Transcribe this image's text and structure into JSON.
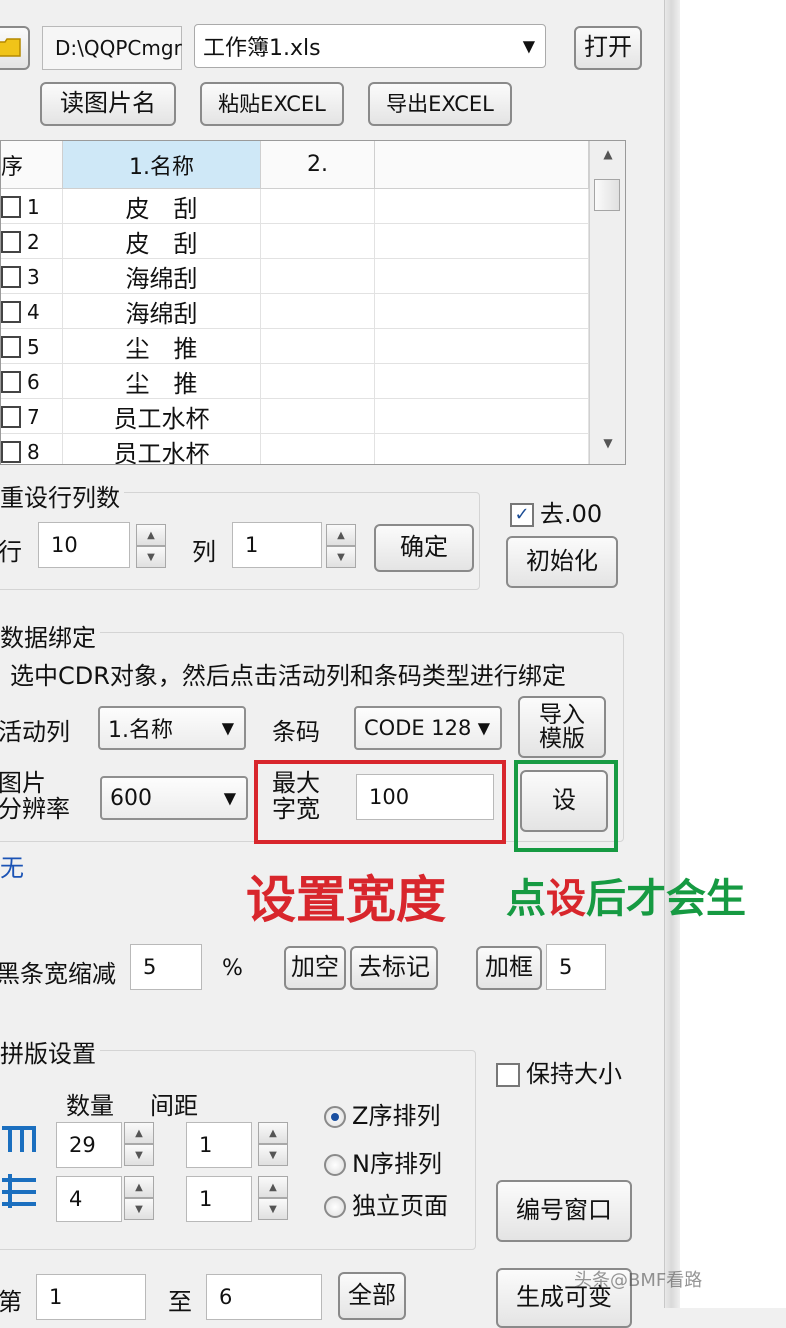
{
  "top": {
    "path_value": "D:\\QQPCmgr",
    "file_combo": "工作簿1.xls",
    "open_btn": "打开",
    "read_names_btn": "读图片名",
    "paste_excel_btn": "粘贴EXCEL",
    "export_excel_btn": "导出EXCEL"
  },
  "grid": {
    "headers": [
      "序",
      "1.名称",
      "2."
    ],
    "rows": [
      {
        "num": "1",
        "name": "皮　刮"
      },
      {
        "num": "2",
        "name": "皮　刮"
      },
      {
        "num": "3",
        "name": "海绵刮"
      },
      {
        "num": "4",
        "name": "海绵刮"
      },
      {
        "num": "5",
        "name": "尘　推"
      },
      {
        "num": "6",
        "name": "尘　推"
      },
      {
        "num": "7",
        "name": "员工水杯"
      },
      {
        "num": "8",
        "name": "员工水杯"
      }
    ]
  },
  "reset": {
    "title": "重设行列数",
    "row_label": "行",
    "row_value": "10",
    "col_label": "列",
    "col_value": "1",
    "ok_btn": "确定",
    "strip_zero_label": "去.00",
    "strip_zero_checked": true,
    "init_btn": "初始化"
  },
  "binding": {
    "title": "数据绑定",
    "hint": "选中CDR对象，然后点击活动列和条码类型进行绑定",
    "active_col_label": "活动列",
    "active_col_value": "1.名称",
    "barcode_label": "条码",
    "barcode_value": "CODE 128",
    "import_template_btn": "导入\n模版",
    "resolution_label": "图片\n分辨率",
    "resolution_value": "600",
    "max_width_label": "最大\n字宽",
    "max_width_value": "100",
    "set_btn": "设",
    "none_text": "无",
    "annotation_red": "设置宽度",
    "annotation_green_a": "点",
    "annotation_green_b": "设",
    "annotation_green_c": "后才会生"
  },
  "bar": {
    "shrink_label": "黑条宽缩减",
    "shrink_value": "5",
    "percent": "%",
    "add_space_btn": "加空",
    "remove_mark_btn": "去标记",
    "add_frame_btn": "加框",
    "frame_value": "5"
  },
  "layout": {
    "title": "拼版设置",
    "keep_size_label": "保持大小",
    "qty_label": "数量",
    "gap_label": "间距",
    "qty1": "29",
    "gap1": "1",
    "qty2": "4",
    "gap2": "1",
    "radio_z": "Z序排列",
    "radio_n": "N序排列",
    "radio_page": "独立页面",
    "numbering_btn": "编号窗口"
  },
  "bottom": {
    "from_label": "第",
    "from_value": "1",
    "to_label": "至",
    "to_value": "6",
    "all_btn": "全部",
    "generate_btn": "生成可变"
  },
  "watermark": "头条@BMF看路"
}
